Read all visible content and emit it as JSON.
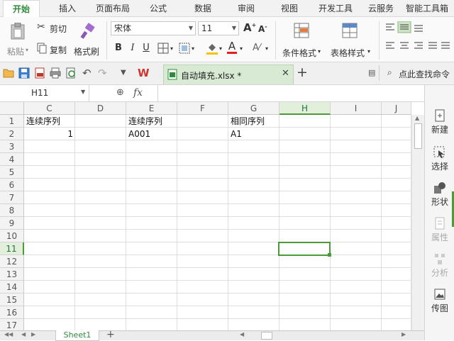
{
  "menubar": {
    "tabs": [
      "开始",
      "插入",
      "页面布局",
      "公式",
      "数据",
      "审阅",
      "视图",
      "开发工具",
      "云服务",
      "智能工具箱"
    ],
    "active_index": 0
  },
  "ribbon": {
    "paste_label": "粘贴",
    "cut_label": "剪切",
    "copy_label": "复制",
    "format_painter_label": "格式刷",
    "font_name": "宋体",
    "font_size": "11",
    "bold": "B",
    "italic": "I",
    "underline": "U",
    "font_color_glyph": "A",
    "cond_format_label": "条件格式",
    "table_style_label": "表格样式",
    "accent_color": "#2e8b3a",
    "font_color": "#e02020",
    "fill_color": "#f5c400"
  },
  "quickbar": {
    "doc_title": "自动填充.xlsx *",
    "find_label": "点此查找命令",
    "wps_glyph": "W"
  },
  "formula_bar": {
    "name_box": "H11",
    "fx_label": "fx"
  },
  "columns": [
    "C",
    "D",
    "E",
    "F",
    "G",
    "H",
    "I",
    "J"
  ],
  "selected_column": "H",
  "rows": [
    "1",
    "2",
    "3",
    "4",
    "5",
    "6",
    "7",
    "8",
    "9",
    "10",
    "11",
    "12",
    "13",
    "14",
    "15",
    "16",
    "17"
  ],
  "selected_row": "11",
  "cells": {
    "C1": "连续序列",
    "C2": "1",
    "E1": "连续序列",
    "E2": "A001",
    "G1": "相同序列",
    "G2": "A1"
  },
  "side_panel": {
    "items": [
      "新建",
      "选择",
      "形状",
      "属性",
      "分析",
      "传图"
    ]
  },
  "sheet_tab": "Sheet1"
}
